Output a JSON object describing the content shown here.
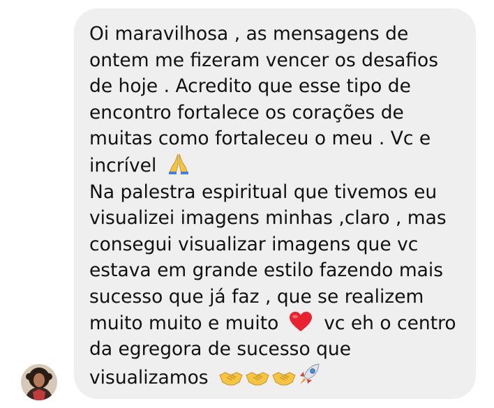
{
  "message": {
    "lines": [
      "Oi maravilhosa , as mensagens de",
      "ontem me fizeram vencer os desafios",
      "de hoje . Acredito que esse tipo de",
      "encontro fortalece os corações de",
      "muitas como fortaleceu o meu . Vc e",
      "incrível",
      "Na palestra espiritual que tivemos eu",
      "visualizei imagens minhas ,claro , mas",
      "consegui visualizar imagens que vc",
      "estava em grande estilo fazendo mais",
      "sucesso que já faz , que se realizem",
      "muito muito e muito",
      "vc eh o centro",
      "da egregora de sucesso que",
      "visualizamos"
    ],
    "emojis": {
      "praying": "folded-hands",
      "heart": "red-heart",
      "handshake": "handshake",
      "rocket": "rocket"
    }
  },
  "avatar": {
    "name": "sender-avatar"
  }
}
